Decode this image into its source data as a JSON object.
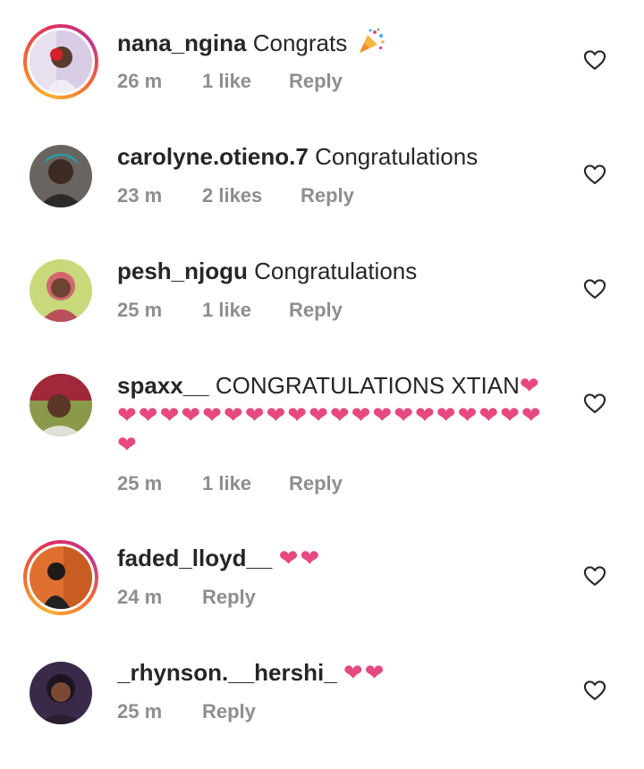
{
  "comments": [
    {
      "username": "nana_ngina",
      "text": "Congrats",
      "emoji": "party-popper-icon",
      "time": "26 m",
      "likes": "1 like",
      "reply": "Reply",
      "story_ring": true
    },
    {
      "username": "carolyne.otieno.7",
      "text": "Congratulations",
      "time": "23 m",
      "likes": "2 likes",
      "reply": "Reply",
      "story_ring": false
    },
    {
      "username": "pesh_njogu",
      "text": "Congratulations",
      "time": "25 m",
      "likes": "1 like",
      "reply": "Reply",
      "story_ring": false
    },
    {
      "username": "spaxx__",
      "text": "CONGRATULATIONS XTIAN",
      "hearts": "❤❤❤❤❤❤❤❤❤❤❤❤❤❤❤❤❤❤❤❤❤❤",
      "time": "25 m",
      "likes": "1 like",
      "reply": "Reply",
      "story_ring": false
    },
    {
      "username": "faded_lloyd__",
      "hearts": "❤❤",
      "time": "24 m",
      "reply": "Reply",
      "story_ring": true
    },
    {
      "username": "_rhynson.__hershi_",
      "hearts": "❤❤",
      "time": "25 m",
      "reply": "Reply",
      "story_ring": false
    }
  ],
  "colors": {
    "heart": "#e5497f",
    "meta": "#8e8e8e",
    "text": "#262626"
  },
  "icons": {
    "like": "heart-outline-icon"
  }
}
